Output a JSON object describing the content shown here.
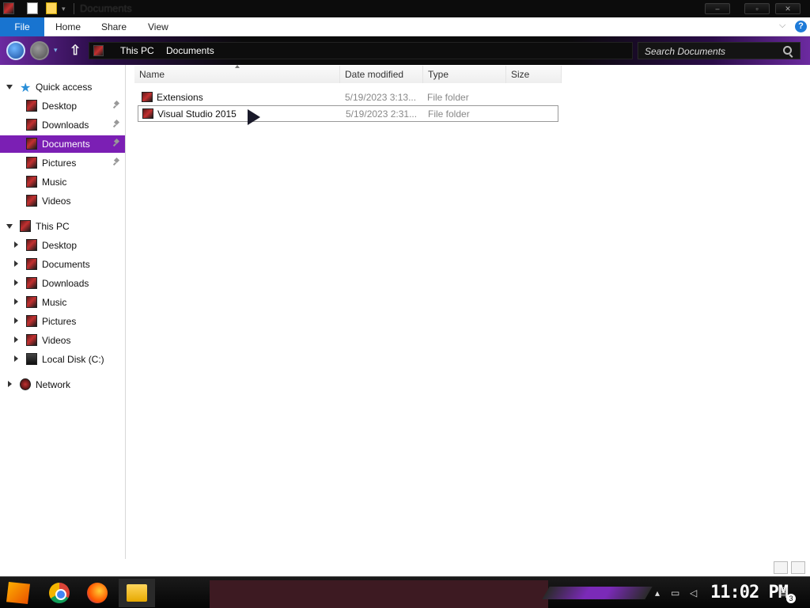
{
  "window": {
    "title": "Documents"
  },
  "ribbon": {
    "tabs": [
      "File",
      "Home",
      "Share",
      "View"
    ]
  },
  "address": {
    "crumbs": [
      "This PC",
      "Documents"
    ]
  },
  "search": {
    "placeholder": "Search Documents"
  },
  "sidebar": {
    "quick_access": {
      "label": "Quick access",
      "items": [
        {
          "label": "Desktop",
          "pinned": true
        },
        {
          "label": "Downloads",
          "pinned": true
        },
        {
          "label": "Documents",
          "pinned": true,
          "selected": true
        },
        {
          "label": "Pictures",
          "pinned": true
        },
        {
          "label": "Music",
          "pinned": false
        },
        {
          "label": "Videos",
          "pinned": false
        }
      ]
    },
    "this_pc": {
      "label": "This PC",
      "items": [
        "Desktop",
        "Documents",
        "Downloads",
        "Music",
        "Pictures",
        "Videos",
        "Local Disk (C:)"
      ]
    },
    "network": {
      "label": "Network"
    }
  },
  "columns": [
    "Name",
    "Date modified",
    "Type",
    "Size"
  ],
  "files": [
    {
      "name": "Extensions",
      "date": "5/19/2023 3:13...",
      "type": "File folder",
      "size": ""
    },
    {
      "name": "Visual Studio 2015",
      "date": "5/19/2023 2:31...",
      "type": "File folder",
      "size": "",
      "selected": true
    }
  ],
  "taskbar": {
    "clock": "11:02 PM",
    "notifications": "3"
  },
  "colors": {
    "accent": "#7b1fb4",
    "file_tab": "#1874d0"
  }
}
